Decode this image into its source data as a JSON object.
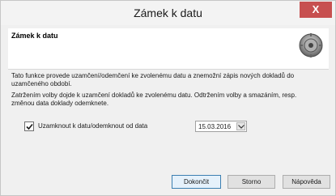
{
  "window": {
    "title": "Zámek k datu",
    "close_label": "X"
  },
  "header": {
    "title": "Zámek k datu",
    "icon": "lock-gear-icon"
  },
  "body": {
    "description_1": "Tato funkce provede uzamčení/odemčení ke zvolenému datu a znemožní zápis nových dokladů do uzamčeného období.",
    "description_2": "Zatržením volby dojde k uzamčení dokladů ke zvolenému datu. Odtržením volby a smazáním, resp. změnou data doklady odemknete."
  },
  "lock_option": {
    "checked": true,
    "label": "Uzamknout k datu/odemknout od data",
    "date_value": "15.03.2016"
  },
  "buttons": {
    "finish": "Dokončit",
    "cancel": "Storno",
    "help": "Nápověda"
  },
  "colors": {
    "close_button": "#c75050",
    "default_button_border": "#3c7fb1",
    "dialog_background": "#f0f0f0"
  }
}
